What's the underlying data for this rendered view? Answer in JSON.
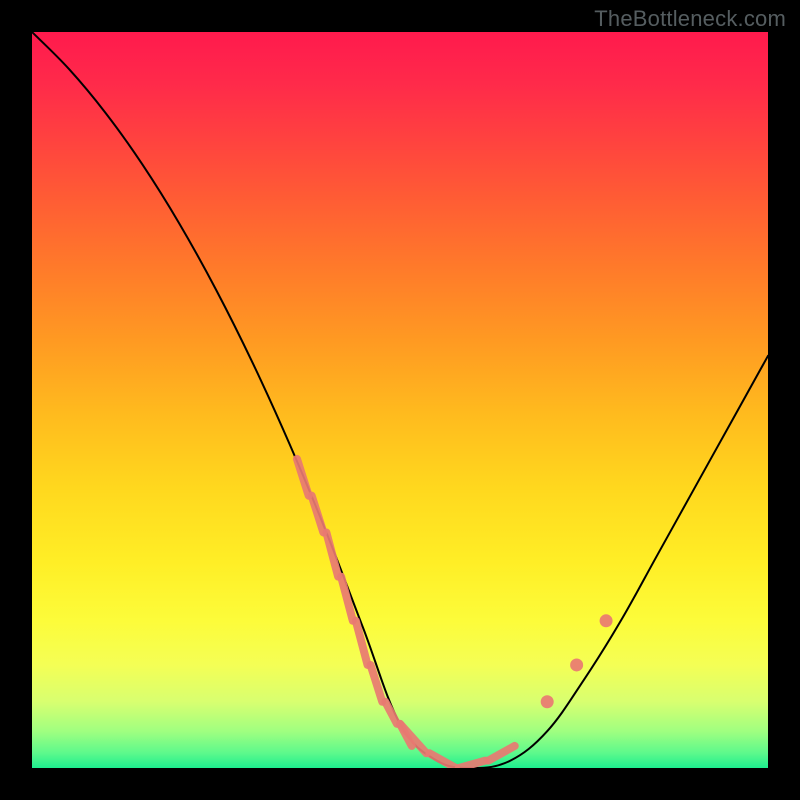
{
  "watermark": {
    "text": "TheBottleneck.com"
  },
  "chart_data": {
    "type": "line",
    "title": "",
    "xlabel": "",
    "ylabel": "",
    "xlim": [
      0,
      100
    ],
    "ylim": [
      0,
      100
    ],
    "grid": false,
    "legend": false,
    "background_gradient": {
      "stops": [
        {
          "pos": 0.0,
          "color": "#ff1a4d"
        },
        {
          "pos": 0.3,
          "color": "#ff7a2a"
        },
        {
          "pos": 0.6,
          "color": "#ffd81e"
        },
        {
          "pos": 0.82,
          "color": "#fcfc3a"
        },
        {
          "pos": 0.95,
          "color": "#a0ff80"
        },
        {
          "pos": 1.0,
          "color": "#1eee8e"
        }
      ]
    },
    "series": [
      {
        "name": "bottleneck-curve",
        "type": "line",
        "color": "#000000",
        "x": [
          0,
          5,
          10,
          15,
          20,
          25,
          30,
          35,
          40,
          45,
          50,
          55,
          60,
          65,
          70,
          75,
          80,
          85,
          90,
          95,
          100
        ],
        "values": [
          100,
          95,
          89,
          82,
          74,
          65,
          55,
          44,
          32,
          19,
          6,
          1,
          0,
          1,
          5,
          12,
          20,
          29,
          38,
          47,
          56
        ]
      },
      {
        "name": "highlight-left",
        "type": "line",
        "color": "#e97a72",
        "stroke_width": 8,
        "x": [
          36,
          38,
          40,
          42,
          44,
          46,
          48,
          50,
          52
        ],
        "values": [
          42,
          37,
          32,
          26,
          20,
          14,
          9,
          6,
          3
        ]
      },
      {
        "name": "highlight-bottom",
        "type": "line",
        "color": "#e97a72",
        "stroke_width": 8,
        "x": [
          50,
          54,
          58,
          62,
          66
        ],
        "values": [
          6,
          2,
          0,
          1,
          3
        ]
      },
      {
        "name": "highlight-right",
        "type": "scatter",
        "color": "#e97a72",
        "point_size": 9,
        "x": [
          70,
          74,
          78
        ],
        "values": [
          9,
          14,
          20
        ]
      }
    ]
  }
}
